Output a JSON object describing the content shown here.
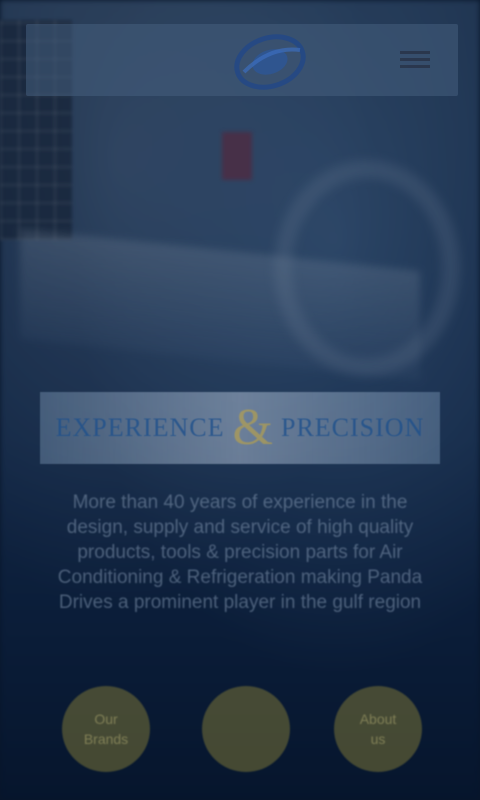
{
  "header": {
    "logo_name": "company-logo",
    "menu_icon": "hamburger-menu-icon"
  },
  "hero": {
    "banner": {
      "word_left": "EXPERIENCE",
      "ampersand": "&",
      "word_right": "PRECISION"
    },
    "description": "More than 40 years of experience in the design, supply and service of high quality products, tools & precision parts for Air Conditioning & Refrigeration making Panda Drives a prominent player in the gulf region"
  },
  "actions": [
    {
      "label_line1": "Our",
      "label_line2": "Brands"
    },
    {
      "label_line1": "",
      "label_line2": ""
    },
    {
      "label_line1": "About",
      "label_line2": "us"
    }
  ],
  "colors": {
    "accent_gold": "#78733a",
    "header_bg": "#465f7d",
    "page_bg": "#0a1a2e"
  }
}
